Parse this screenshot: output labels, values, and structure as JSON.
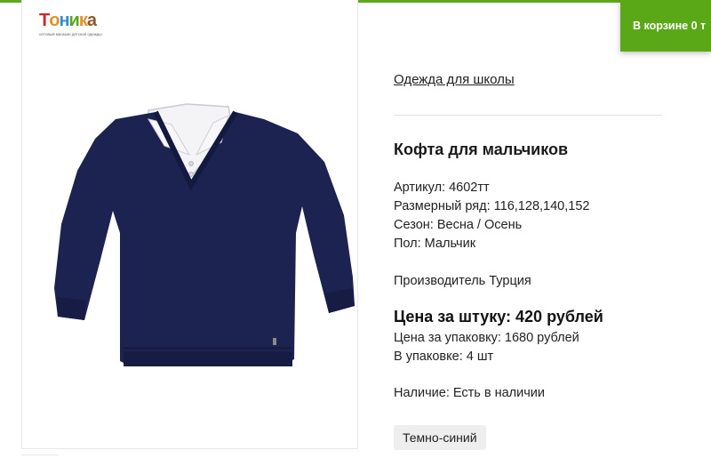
{
  "colors": {
    "accent_green": "#5aa717",
    "text": "#222222",
    "sweater_navy": "#1c2350"
  },
  "header": {
    "logo_text": "Тоника",
    "logo_subtitle": "оптовый магазин детской одежды",
    "cart_label": "В корзине 0 т"
  },
  "breadcrumb": "Одежда для школы",
  "product": {
    "image_icon": "sweater-with-shirt-collar",
    "title": "Кофта для мальчиков",
    "article": "Артикул: 4602тт",
    "sizes": "Размерный ряд: 116,128,140,152",
    "season": "Сезон: Весна / Осень",
    "gender": "Пол: Мальчик",
    "manufacturer": "Производитель Турция",
    "price_unit": "Цена за штуку: 420 рублей",
    "price_pack": "Цена за упаковку: 1680 рублей",
    "pack_count": "В упаковке: 4 шт",
    "availability": "Наличие: Есть в наличии",
    "color_option": "Темно-синий"
  }
}
